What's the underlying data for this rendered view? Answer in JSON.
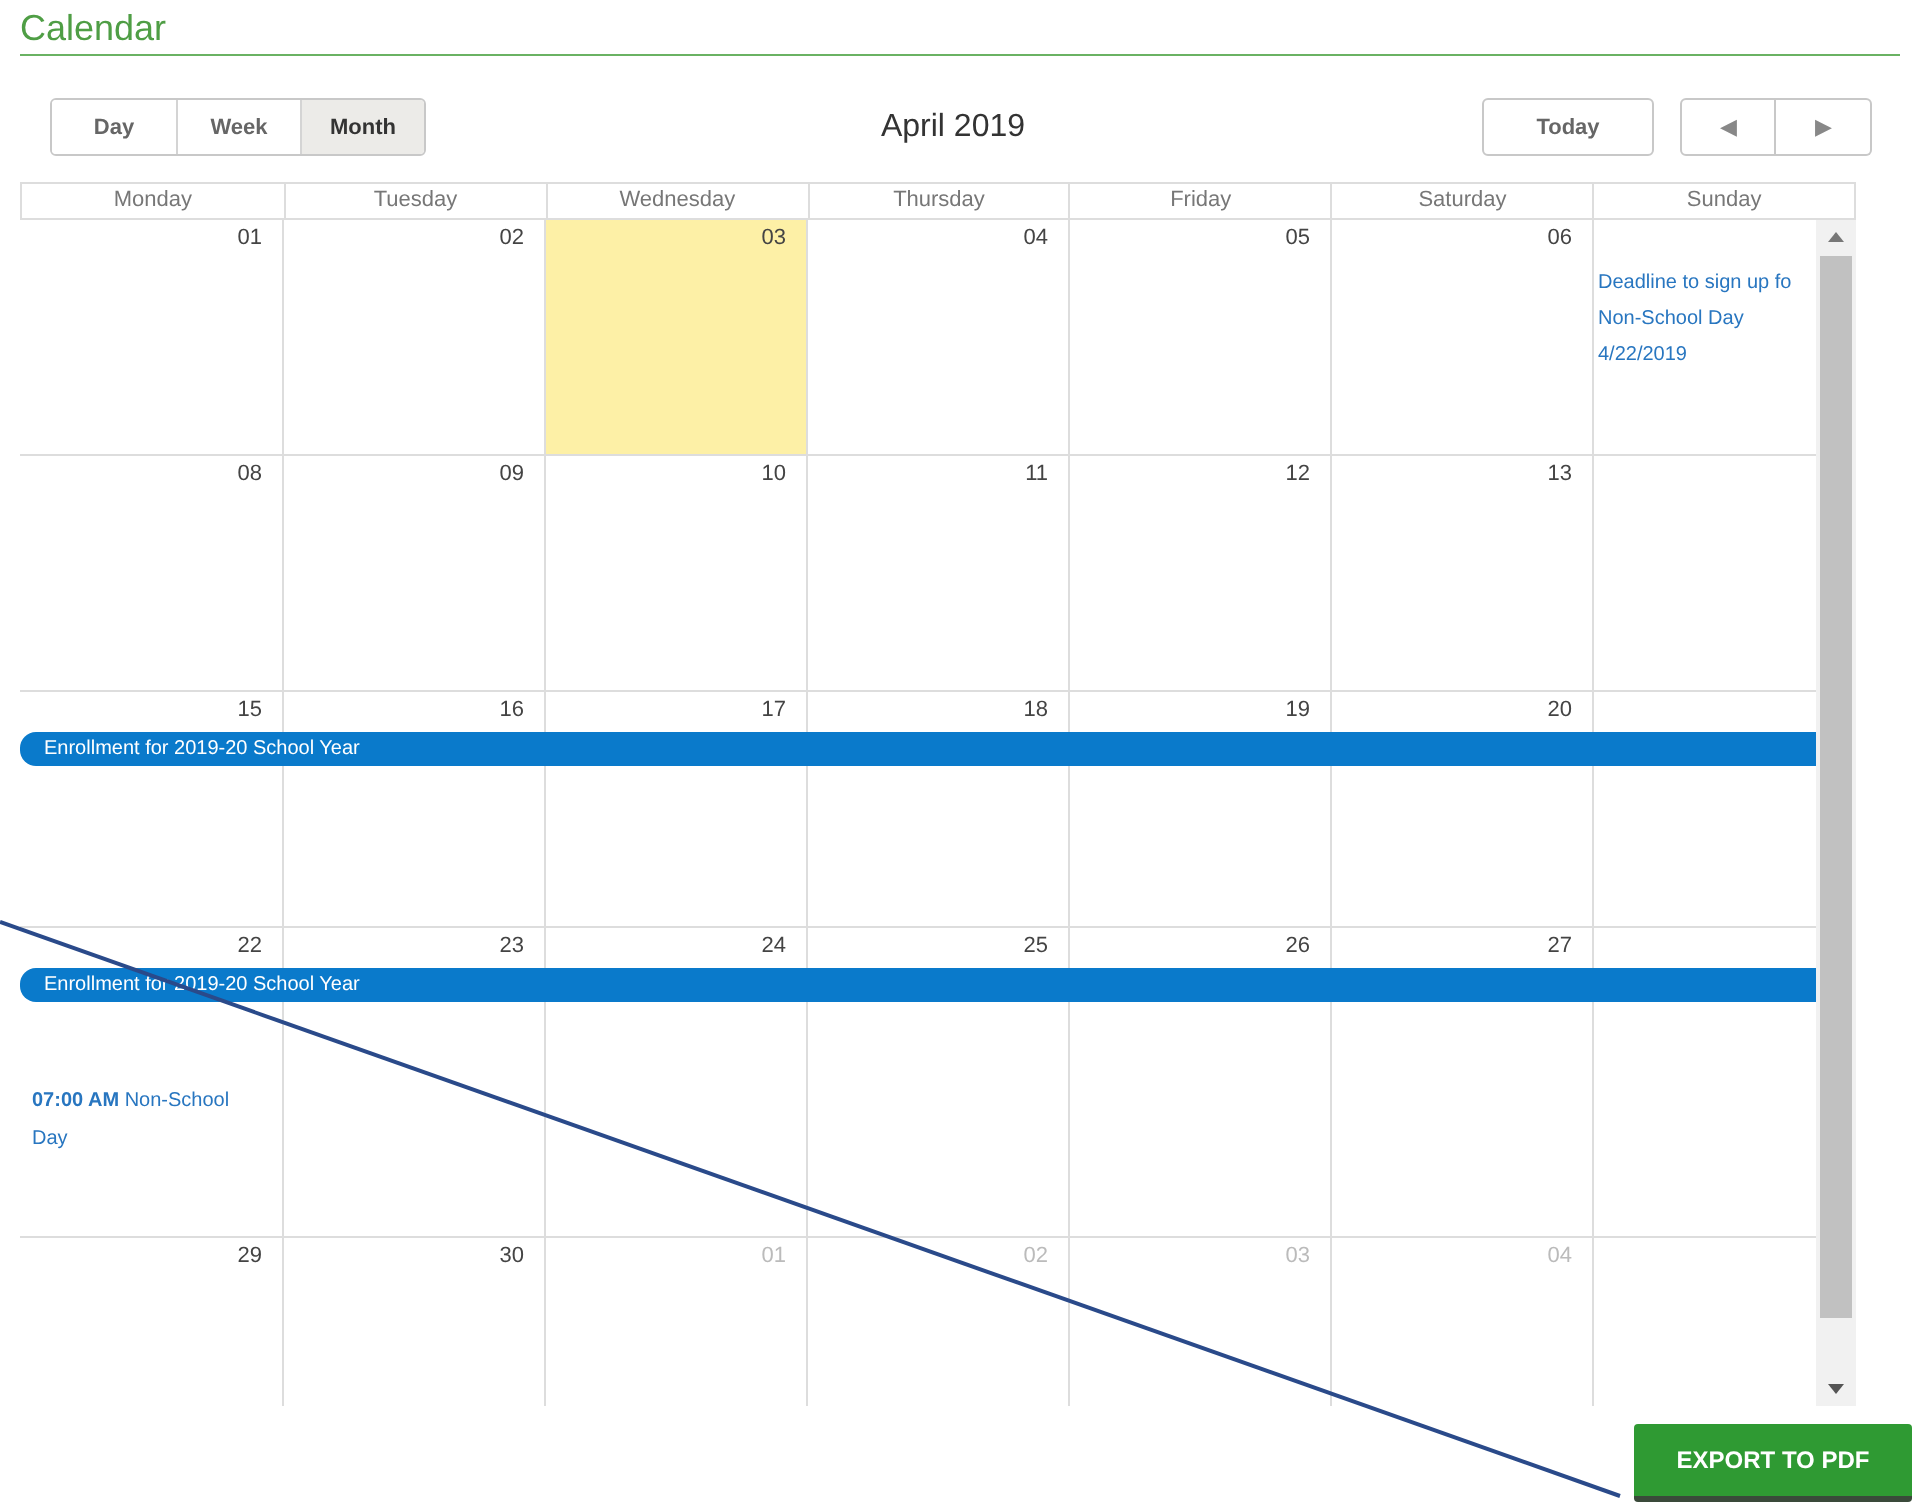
{
  "title": "Calendar",
  "views": [
    {
      "label": "Day",
      "selected": false
    },
    {
      "label": "Week",
      "selected": false
    },
    {
      "label": "Month",
      "selected": true
    }
  ],
  "period": "April 2019",
  "today_button": "Today",
  "nav": [
    "◀",
    "▶"
  ],
  "weekdays": [
    "Monday",
    "Tuesday",
    "Wednesday",
    "Thursday",
    "Friday",
    "Saturday",
    "Sunday"
  ],
  "weeks": [
    {
      "days": [
        {
          "number": "01",
          "muted": false,
          "today": false
        },
        {
          "number": "02",
          "muted": false,
          "today": false
        },
        {
          "number": "03",
          "muted": false,
          "today": true
        },
        {
          "number": "04",
          "muted": false,
          "today": false
        },
        {
          "number": "05",
          "muted": false,
          "today": false
        },
        {
          "number": "06",
          "muted": false,
          "today": false
        },
        {
          "today": false,
          "events": [
            "Deadline to sign up fo",
            "Non-School Day",
            "4/22/2019"
          ]
        }
      ]
    },
    {
      "days": [
        {
          "number": "08",
          "muted": false,
          "today": false
        },
        {
          "number": "09",
          "muted": false,
          "today": false
        },
        {
          "number": "10",
          "muted": false,
          "today": false
        },
        {
          "number": "11",
          "muted": false,
          "today": false
        },
        {
          "number": "12",
          "muted": false,
          "today": false
        },
        {
          "number": "13",
          "muted": false,
          "today": false
        }
      ]
    },
    {
      "banner": "Enrollment for 2019-20 School Year",
      "days": [
        {
          "number": "15",
          "muted": false,
          "today": false
        },
        {
          "number": "16",
          "muted": false,
          "today": false
        },
        {
          "number": "17",
          "muted": false,
          "today": false
        },
        {
          "number": "18",
          "muted": false,
          "today": false
        },
        {
          "number": "19",
          "muted": false,
          "today": false
        },
        {
          "number": "20",
          "muted": false,
          "today": false
        }
      ]
    },
    {
      "banner": "Enrollment for 2019-20 School Year",
      "days": [
        {
          "number": "22",
          "muted": false,
          "today": false,
          "events": [
            "**07:00 AM** Non-School Day"
          ]
        },
        {
          "number": "23",
          "muted": false,
          "today": false
        },
        {
          "number": "24",
          "muted": false,
          "today": false
        },
        {
          "number": "25",
          "muted": false,
          "today": false
        },
        {
          "number": "26",
          "muted": false,
          "today": false
        },
        {
          "number": "27",
          "muted": false,
          "today": false
        }
      ]
    },
    {
      "days": [
        {
          "number": "29",
          "muted": false,
          "today": false
        },
        {
          "number": "30",
          "muted": false,
          "today": false
        },
        {
          "number": "01",
          "muted": true,
          "today": false
        },
        {
          "number": "02",
          "muted": true,
          "today": false
        },
        {
          "number": "03",
          "muted": true,
          "today": false
        },
        {
          "number": "04",
          "muted": true,
          "today": false
        }
      ]
    }
  ],
  "export_button": "EXPORT TO PDF"
}
